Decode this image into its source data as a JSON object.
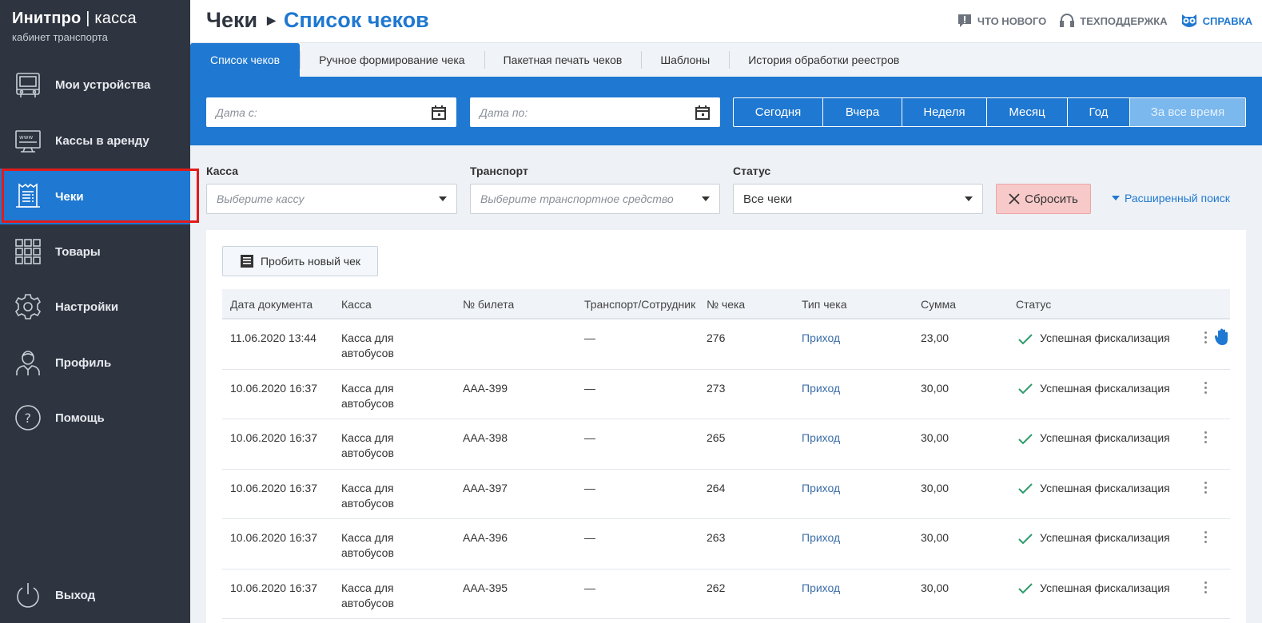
{
  "brand": {
    "title_bold": "Инитпро",
    "title_sep": " | ",
    "title_thin": "касса",
    "subtitle": "кабинет транспорта"
  },
  "sidebar": {
    "items": [
      {
        "label": "Мои устройства",
        "icon": "bus-icon"
      },
      {
        "label": "Кассы в аренду",
        "icon": "monitor-www-icon"
      },
      {
        "label": "Чеки",
        "icon": "receipt-icon",
        "active": true
      },
      {
        "label": "Товары",
        "icon": "grid-icon"
      },
      {
        "label": "Настройки",
        "icon": "gear-icon"
      },
      {
        "label": "Профиль",
        "icon": "user-icon"
      },
      {
        "label": "Помощь",
        "icon": "help-icon"
      }
    ],
    "logout": "Выход"
  },
  "header": {
    "crumb_parent": "Чеки",
    "crumb_current": "Список чеков",
    "links": {
      "news": "ЧТО НОВОГО",
      "support": "ТЕХПОДДЕРЖКА",
      "help": "СПРАВКА"
    }
  },
  "tabs": [
    "Список чеков",
    "Ручное формирование чека",
    "Пакетная печать чеков",
    "Шаблоны",
    "История обработки реестров"
  ],
  "datebar": {
    "from_placeholder": "Дата с:",
    "to_placeholder": "Дата по:",
    "periods": [
      "Сегодня",
      "Вчера",
      "Неделя",
      "Месяц",
      "Год",
      "За все время"
    ],
    "selected_period": "За все время"
  },
  "filters": {
    "kassa": {
      "label": "Касса",
      "placeholder": "Выберите кассу"
    },
    "transport": {
      "label": "Транспорт",
      "placeholder": "Выберите транспортное средство"
    },
    "status": {
      "label": "Статус",
      "value": "Все чеки"
    },
    "reset": "Сбросить",
    "advanced": "Расширенный поиск"
  },
  "new_receipt_button": "Пробить новый чек",
  "table": {
    "columns": [
      "Дата документа",
      "Касса",
      "№ билета",
      "Транспорт/Сотрудник",
      "№ чека",
      "Тип чека",
      "Сумма",
      "Статус"
    ],
    "rows": [
      {
        "date": "11.06.2020 13:44",
        "kassa": "Касса для автобусов",
        "ticket": "",
        "transport": "—",
        "check_no": "276",
        "type": "Приход",
        "sum": "23,00",
        "status": "Успешная фискализация"
      },
      {
        "date": "10.06.2020 16:37",
        "kassa": "Касса для автобусов",
        "ticket": "AAA-399",
        "transport": "—",
        "check_no": "273",
        "type": "Приход",
        "sum": "30,00",
        "status": "Успешная фискализация"
      },
      {
        "date": "10.06.2020 16:37",
        "kassa": "Касса для автобусов",
        "ticket": "AAA-398",
        "transport": "—",
        "check_no": "265",
        "type": "Приход",
        "sum": "30,00",
        "status": "Успешная фискализация"
      },
      {
        "date": "10.06.2020 16:37",
        "kassa": "Касса для автобусов",
        "ticket": "AAA-397",
        "transport": "—",
        "check_no": "264",
        "type": "Приход",
        "sum": "30,00",
        "status": "Успешная фискализация"
      },
      {
        "date": "10.06.2020 16:37",
        "kassa": "Касса для автобусов",
        "ticket": "AAA-396",
        "transport": "—",
        "check_no": "263",
        "type": "Приход",
        "sum": "30,00",
        "status": "Успешная фискализация"
      },
      {
        "date": "10.06.2020 16:37",
        "kassa": "Касса для автобусов",
        "ticket": "AAA-395",
        "transport": "—",
        "check_no": "262",
        "type": "Приход",
        "sum": "30,00",
        "status": "Успешная фискализация"
      }
    ]
  },
  "colors": {
    "sidebar_bg": "#2f3540",
    "accent": "#1f78d1",
    "highlight": "#e21b1b",
    "success": "#2e9b6a"
  }
}
